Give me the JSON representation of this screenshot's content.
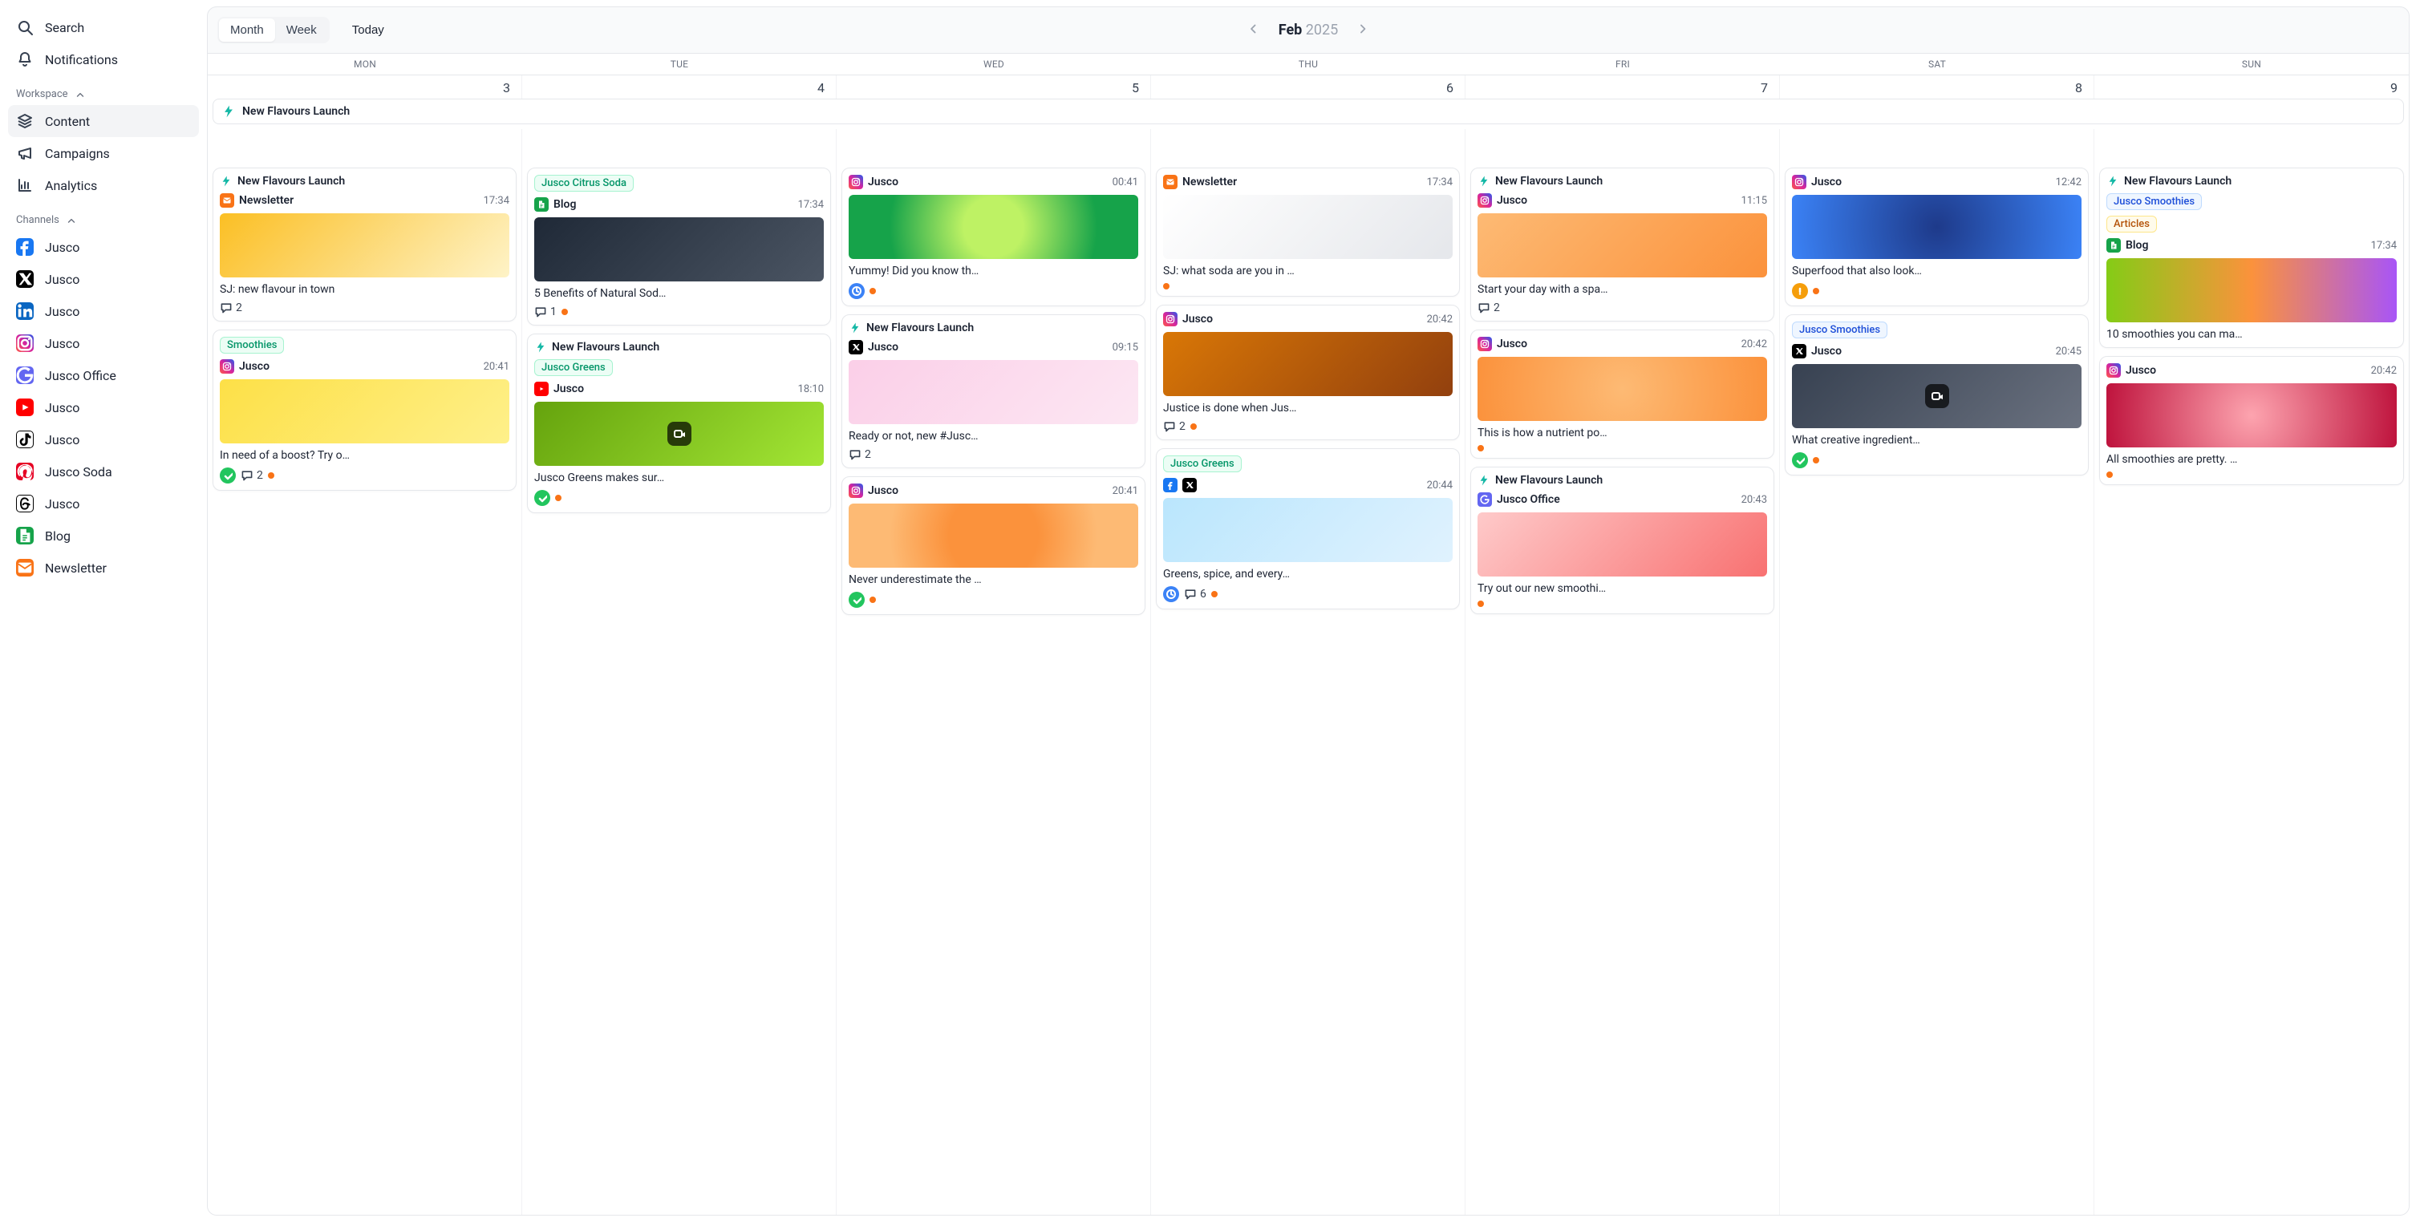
{
  "sidebar": {
    "search": "Search",
    "notifications": "Notifications",
    "groups": {
      "workspace": "Workspace",
      "channels": "Channels"
    },
    "workspace": [
      {
        "label": "Content",
        "icon": "layers",
        "active": true
      },
      {
        "label": "Campaigns",
        "icon": "megaphone"
      },
      {
        "label": "Analytics",
        "icon": "bar-chart"
      }
    ],
    "channels": [
      {
        "label": "Jusco",
        "net": "facebook"
      },
      {
        "label": "Jusco",
        "net": "x"
      },
      {
        "label": "Jusco",
        "net": "linkedin"
      },
      {
        "label": "Jusco",
        "net": "instagram"
      },
      {
        "label": "Jusco Office",
        "net": "google"
      },
      {
        "label": "Jusco",
        "net": "youtube"
      },
      {
        "label": "Jusco",
        "net": "tiktok"
      },
      {
        "label": "Jusco Soda",
        "net": "pinterest"
      },
      {
        "label": "Jusco",
        "net": "threads"
      },
      {
        "label": "Blog",
        "net": "blog"
      },
      {
        "label": "Newsletter",
        "net": "newsletter"
      }
    ]
  },
  "calendar": {
    "views": {
      "month": "Month",
      "week": "Week",
      "active": "month"
    },
    "today": "Today",
    "month": "Feb",
    "year": "2025",
    "weekdays": [
      "MON",
      "TUE",
      "WED",
      "THU",
      "FRI",
      "SAT",
      "SUN"
    ],
    "dates": [
      "3",
      "4",
      "5",
      "6",
      "7",
      "8",
      "9"
    ],
    "span_event": "New Flavours Launch"
  },
  "campaign_label": "New Flavours Launch",
  "cards": {
    "mon1": {
      "campaign": "New Flavours Launch",
      "channel_icon": "newsletter",
      "channel": "Newsletter",
      "time": "17:34",
      "thumb": "th-orange",
      "caption": "SJ: new flavour in town",
      "comments": "2"
    },
    "mon2": {
      "tag": "Smoothies",
      "tag_cls": "tag-green",
      "channel_icon": "instagram",
      "channel": "Jusco",
      "time": "20:41",
      "thumb": "th-yellow",
      "caption": "In need of a boost? Try o…",
      "status": "ok",
      "comments": "2",
      "dot": true
    },
    "tue1": {
      "tag": "Jusco Citrus Soda",
      "tag_cls": "tag-green",
      "channel_icon": "blog",
      "channel": "Blog",
      "time": "17:34",
      "thumb": "th-dark",
      "caption": "5 Benefits of Natural Sod…",
      "comments": "1",
      "dot": true
    },
    "tue2": {
      "campaign": "New Flavours Launch",
      "tag": "Jusco Greens",
      "tag_cls": "tag-green",
      "channel_icon": "youtube",
      "channel": "Jusco",
      "time": "18:10",
      "thumb": "th-avocado",
      "video": true,
      "caption": "Jusco Greens makes sur…",
      "status": "ok",
      "dot": true
    },
    "wed1": {
      "channel_icon": "instagram",
      "channel": "Jusco",
      "time": "00:41",
      "thumb": "th-kiwi",
      "caption": "Yummy! Did you know th…",
      "status": "clock",
      "dot": true
    },
    "wed2": {
      "campaign": "New Flavours Launch",
      "channel_icon": "x",
      "channel": "Jusco",
      "time": "09:15",
      "thumb": "th-hand",
      "caption": "Ready or not, new #Jusc…",
      "comments": "2"
    },
    "wed3": {
      "channel_icon": "instagram",
      "channel": "Jusco",
      "time": "20:41",
      "thumb": "th-citrus",
      "caption": "Never underestimate the …",
      "status": "ok",
      "dot": true
    },
    "thu1": {
      "channel_icon": "newsletter",
      "channel": "Newsletter",
      "time": "17:34",
      "thumb": "th-bottle",
      "caption": "SJ: what soda are you in …",
      "dot": true
    },
    "thu2": {
      "channel_icon": "instagram",
      "channel": "Jusco",
      "time": "20:42",
      "thumb": "th-wood",
      "caption": "Justice is done when Jus…",
      "comments": "2",
      "dot": true
    },
    "thu3": {
      "tag": "Jusco Greens",
      "tag_cls": "tag-green",
      "channels": [
        "facebook",
        "x"
      ],
      "time": "20:44",
      "thumb": "th-mint",
      "caption": "Greens, spice, and every…",
      "status": "clock",
      "comments": "6",
      "dot": true
    },
    "fri1": {
      "campaign": "New Flavours Launch",
      "channel_icon": "instagram",
      "channel": "Jusco",
      "time": "11:15",
      "thumb": "th-orangebottle",
      "caption": "Start your day with a spa…",
      "comments": "2"
    },
    "fri2": {
      "channel_icon": "instagram",
      "channel": "Jusco",
      "time": "20:42",
      "thumb": "th-apricot",
      "caption": "This is how a nutrient po…",
      "dot": true
    },
    "fri3": {
      "campaign": "New Flavours Launch",
      "channel_icon": "google",
      "channel": "Jusco Office",
      "time": "20:43",
      "thumb": "th-box",
      "caption": "Try out our new smoothi…",
      "dot": true
    },
    "sat1": {
      "channel_icon": "instagram",
      "channel": "Jusco",
      "time": "12:42",
      "thumb": "th-blue",
      "caption": "Superfood that also look…",
      "status": "warn",
      "dot": true
    },
    "sat2": {
      "tag": "Jusco Smoothies",
      "tag_cls": "tag-blue",
      "channel_icon": "x",
      "channel": "Jusco",
      "time": "20:45",
      "thumb": "th-darkcup",
      "video": true,
      "caption": "What creative ingredient…",
      "status": "ok",
      "dot": true
    },
    "sun1": {
      "campaign": "New Flavours Launch",
      "tag": "Jusco Smoothies",
      "tag_cls": "tag-blue",
      "tag2": "Articles",
      "tag2_cls": "tag-amber",
      "channel_icon": "blog",
      "channel": "Blog",
      "time": "17:34",
      "thumb": "th-smoothies",
      "caption": "10 smoothies you can ma…"
    },
    "sun2": {
      "channel_icon": "instagram",
      "channel": "Jusco",
      "time": "20:42",
      "thumb": "th-bowl",
      "caption": "All smoothies are pretty. …",
      "dot": true
    }
  }
}
